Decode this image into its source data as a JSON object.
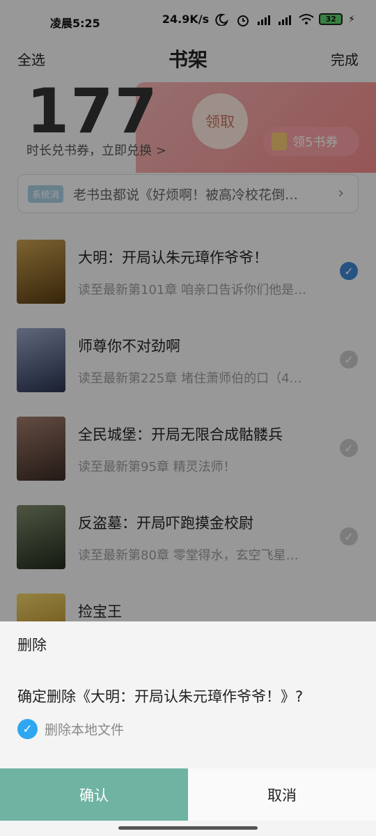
{
  "status_bar": {
    "time": "凌晨5:25",
    "network_speed": "24.9K/s",
    "battery": "32",
    "icons": [
      "moon-icon",
      "alarm-icon",
      "signal-hd-icon",
      "signal-icon",
      "wifi-icon",
      "battery-icon",
      "charging-icon"
    ]
  },
  "header": {
    "select_all": "全选",
    "title": "书架",
    "done": "完成"
  },
  "banner": {
    "minutes": "177",
    "subtitle": "时长兑书券，立即兑换 >",
    "claim_label": "领取",
    "voucher_label": "领5书券"
  },
  "notice": {
    "tag": "系统消",
    "text": "老书虫都说《好烦啊！被高冷校花倒…"
  },
  "books": [
    {
      "title": "大明：开局认朱元璋作爷爷！",
      "desc": "读至最新第101章 咱亲口告诉你们他是…",
      "selected": true,
      "cover_color": "#8a6a2a"
    },
    {
      "title": "师尊你不对劲啊",
      "desc": "读至最新第225章 堵住萧师伯的口（4…",
      "selected": false,
      "cover_color": "#4e5a78"
    },
    {
      "title": "全民城堡：开局无限合成骷髅兵",
      "desc": "读至最新第95章 精灵法师！",
      "selected": false,
      "cover_color": "#6b5246"
    },
    {
      "title": "反盗墓：开局吓跑摸金校尉",
      "desc": "读至最新第80章 零堂得水，玄空飞星…",
      "selected": false,
      "cover_color": "#3e4a3a"
    },
    {
      "title": "捡宝王",
      "desc": "",
      "selected": false,
      "cover_color": "#b8902a"
    }
  ],
  "dialog": {
    "title": "删除",
    "message": "确定删除《大明：开局认朱元璋作爷爷！》?",
    "option_label": "删除本地文件",
    "option_checked": true,
    "confirm": "确认",
    "cancel": "取消"
  },
  "colors": {
    "accent_confirm": "#6fb3a3",
    "checkbox_blue": "#2ea7f0",
    "check_selected": "#3e86d0"
  }
}
